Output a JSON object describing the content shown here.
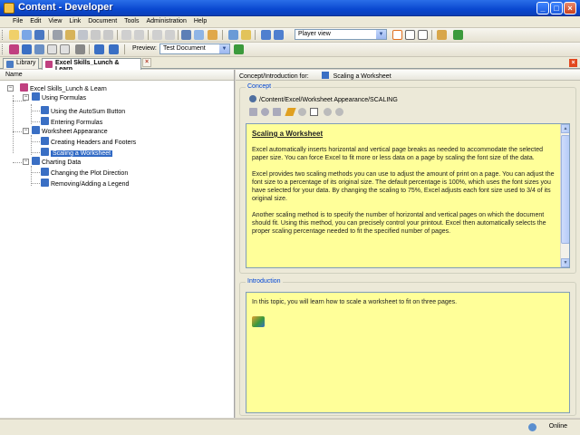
{
  "window": {
    "title": "Content - Developer"
  },
  "menu": [
    "File",
    "Edit",
    "View",
    "Link",
    "Document",
    "Tools",
    "Administration",
    "Help"
  ],
  "toolbar": {
    "view_dropdown": "Player view",
    "preview_label": "Preview:",
    "preview_dropdown": "Test Document"
  },
  "tabs": [
    {
      "label": "Library",
      "active": false
    },
    {
      "label": "Excel Skills_Lunch & Learn",
      "active": true
    }
  ],
  "tree": {
    "header": "Name",
    "root": "Excel Skills_Lunch & Learn",
    "sections": [
      {
        "label": "Using Formulas",
        "items": [
          "Using the AutoSum Button",
          "Entering Formulas"
        ]
      },
      {
        "label": "Worksheet Appearance",
        "items": [
          "Creating Headers and Footers",
          "Scaling a Worksheet"
        ]
      },
      {
        "label": "Charting Data",
        "items": [
          "Changing the Plot Direction",
          "Removing/Adding a Legend"
        ]
      }
    ],
    "selected": "Scaling a Worksheet"
  },
  "right": {
    "header_label": "Concept/Introduction for:",
    "header_value": "Scaling a Worksheet",
    "concept": {
      "group_title": "Concept",
      "path": "/Content/Excel/Worksheet Appearance/SCALING",
      "heading": "Scaling a Worksheet",
      "p1": "Excel automatically inserts horizontal and vertical page breaks as needed to accommodate the selected paper size. You can force Excel to fit more or less data on a page by scaling the font size of the data.",
      "p2": "Excel provides two scaling methods you can use to adjust the amount of print on a page. You can adjust the font size to a percentage of its original size. The default percentage is 100%, which uses the font sizes you have selected for your data. By changing the scaling to 75%, Excel adjusts each font size used to 3/4 of its original size.",
      "p3": "Another scaling method is to specify the number of horizontal and vertical pages on which the document should fit. Using this method, you can precisely control your printout. Excel then automatically selects the proper scaling percentage needed to fit the specified number of pages."
    },
    "introduction": {
      "group_title": "Introduction",
      "text": "In this topic, you will learn how to scale a worksheet to fit on three pages."
    }
  },
  "status": {
    "online": "Online"
  }
}
